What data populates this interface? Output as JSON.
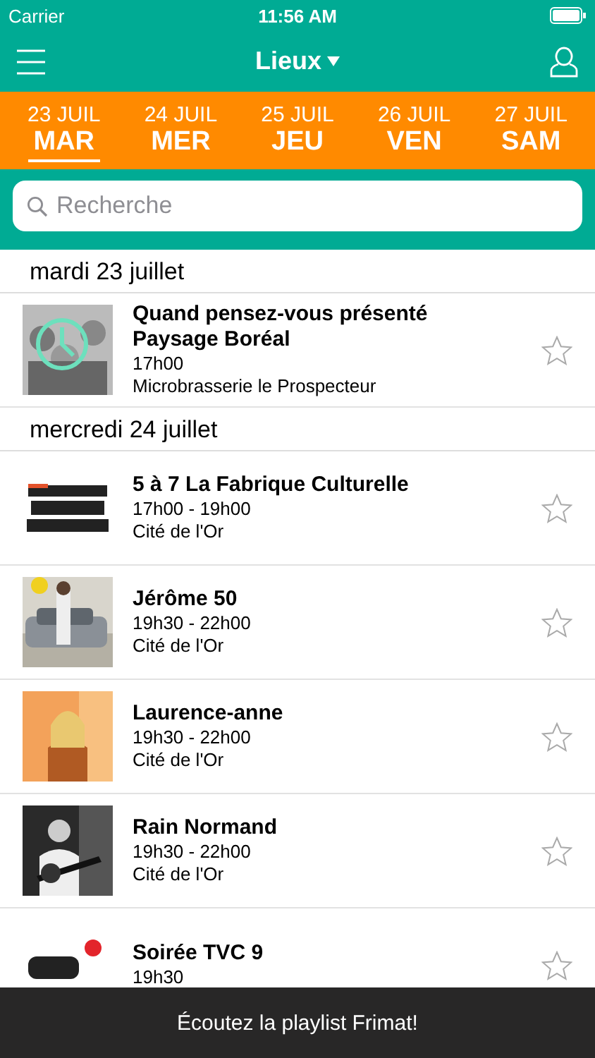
{
  "status_bar": {
    "carrier": "Carrier",
    "time": "11:56 AM"
  },
  "nav": {
    "title": "Lieux"
  },
  "date_tabs": [
    {
      "date": "23 JUIL",
      "day": "MAR",
      "selected": true
    },
    {
      "date": "24 JUIL",
      "day": "MER",
      "selected": false
    },
    {
      "date": "25 JUIL",
      "day": "JEU",
      "selected": false
    },
    {
      "date": "26 JUIL",
      "day": "VEN",
      "selected": false
    },
    {
      "date": "27 JUIL",
      "day": "SAM",
      "selected": false
    }
  ],
  "search": {
    "placeholder": "Recherche"
  },
  "sections": [
    {
      "heading": "mardi 23 juillet",
      "events": [
        {
          "title": "Quand pensez-vous présenté Paysage Boréal",
          "time": "17h00",
          "venue": "Microbrasserie le Prospecteur",
          "starred": false
        }
      ]
    },
    {
      "heading": "mercredi 24 juillet",
      "events": [
        {
          "title": "5 à 7 La Fabrique Culturelle",
          "time": "17h00 - 19h00",
          "venue": "Cité de l'Or",
          "starred": false
        },
        {
          "title": "Jérôme 50",
          "time": "19h30 - 22h00",
          "venue": "Cité de l'Or",
          "starred": false
        },
        {
          "title": "Laurence-anne",
          "time": "19h30 - 22h00",
          "venue": "Cité de l'Or",
          "starred": false
        },
        {
          "title": "Rain Normand",
          "time": "19h30 - 22h00",
          "venue": "Cité de l'Or",
          "starred": false
        },
        {
          "title": "Soirée TVC 9",
          "time": "19h30",
          "starred": false
        }
      ]
    }
  ],
  "bottom_bar": {
    "text": "Écoutez la playlist Frimat!"
  }
}
